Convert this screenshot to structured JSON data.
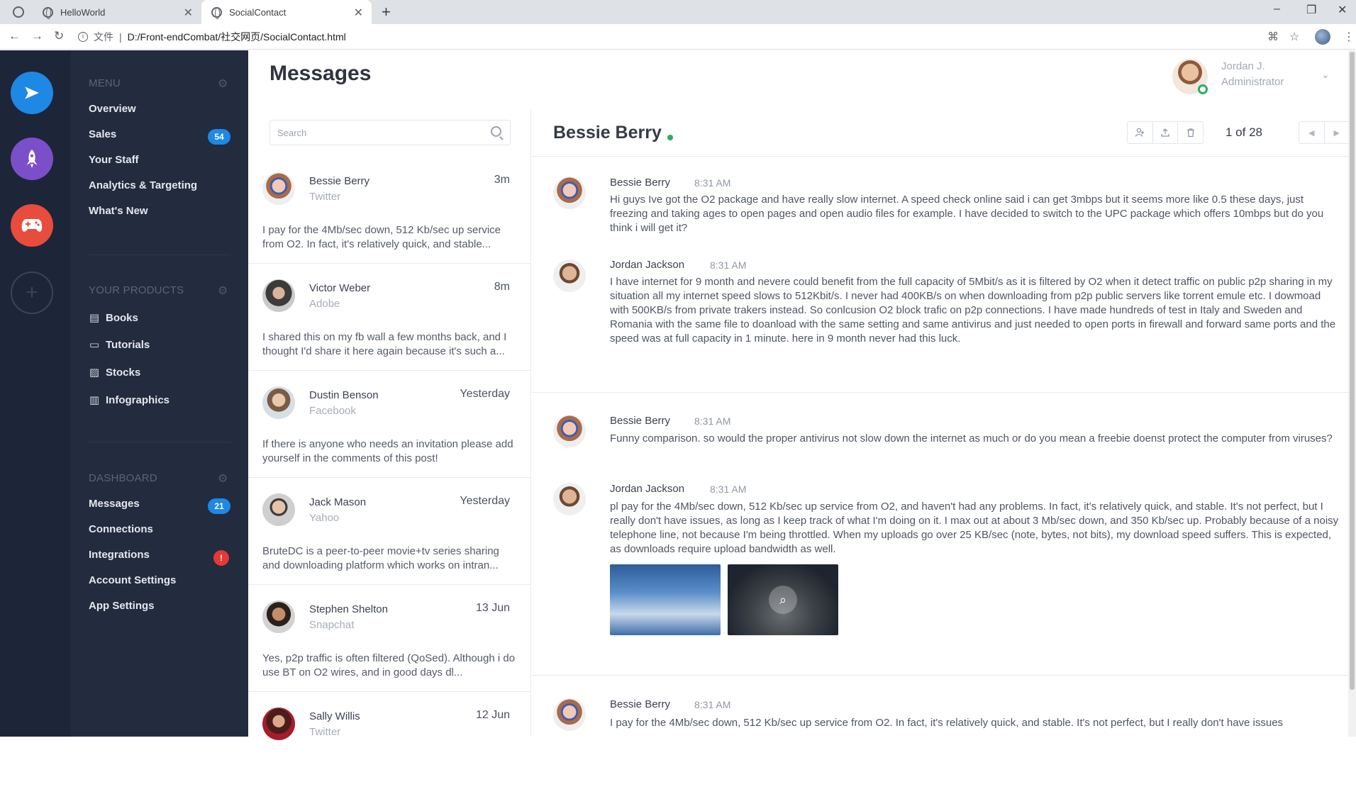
{
  "browser": {
    "tabs": [
      {
        "title": "HelloWorld",
        "active": false
      },
      {
        "title": "SocialContact",
        "active": true
      }
    ],
    "url_scheme_label": "文件",
    "url": "D:/Front-endCombat/社交网页/SocialContact.html"
  },
  "rail": {
    "buttons": [
      {
        "icon": "send-icon",
        "color": "#1e88e5"
      },
      {
        "icon": "rocket-icon",
        "color": "#7b4fc9"
      },
      {
        "icon": "gamepad-icon",
        "color": "#e74c3c"
      },
      {
        "icon": "plus-icon",
        "color": "#3a435a"
      }
    ]
  },
  "sidebar": {
    "menu_title": "MENU",
    "menu": [
      {
        "label": "Overview"
      },
      {
        "label": "Sales",
        "badge": "54"
      },
      {
        "label": "Your Staff"
      },
      {
        "label": "Analytics & Targeting"
      },
      {
        "label": "What's New"
      }
    ],
    "products_title": "YOUR PRODUCTS",
    "products": [
      {
        "label": "Books",
        "icon": "book-icon"
      },
      {
        "label": "Tutorials",
        "icon": "video-icon"
      },
      {
        "label": "Stocks",
        "icon": "image-icon"
      },
      {
        "label": "Infographics",
        "icon": "bar-chart-icon"
      }
    ],
    "dashboard_title": "DASHBOARD",
    "dashboard": [
      {
        "label": "Messages",
        "badge": "21"
      },
      {
        "label": "Connections"
      },
      {
        "label": "Integrations",
        "badge": "!"
      },
      {
        "label": "Account Settings"
      },
      {
        "label": "App Settings"
      }
    ]
  },
  "header": {
    "title": "Messages",
    "user_name": "Jordan J.",
    "user_role": "Administrator"
  },
  "search": {
    "placeholder": "Search"
  },
  "messages": [
    {
      "name": "Bessie Berry",
      "source": "Twitter",
      "time": "3m",
      "preview": "I pay for the 4Mb/sec down, 512 Kb/sec up service from O2. In fact, it's relatively quick, and stable..."
    },
    {
      "name": "Victor Weber",
      "source": "Adobe",
      "time": "8m",
      "preview": "I shared this on my fb wall a few months back, and I thought I'd share it here again because it's such a..."
    },
    {
      "name": "Dustin Benson",
      "source": "Facebook",
      "time": "Yesterday",
      "preview": "If there is anyone who needs an invitation please add yourself in the comments of this post!"
    },
    {
      "name": "Jack Mason",
      "source": "Yahoo",
      "time": "Yesterday",
      "preview": "BruteDC is a peer-to-peer movie+tv series sharing and downloading platform which works on intran..."
    },
    {
      "name": "Stephen Shelton",
      "source": "Snapchat",
      "time": "13 Jun",
      "preview": "Yes, p2p traffic is often filtered (QoSed). Although i do use BT on O2 wires, and in good days dl..."
    },
    {
      "name": "Sally Willis",
      "source": "Twitter",
      "time": "12 Jun",
      "preview": ""
    }
  ],
  "thread": {
    "name": "Bessie Berry",
    "pager": "1 of 28",
    "tools": [
      "add-user-icon",
      "upload-icon",
      "trash-icon"
    ],
    "posts": [
      {
        "author": "Bessie Berry",
        "time": "8:31 AM",
        "text": "Hi guys Ive got the O2 package and have really slow internet. A speed check online said i can get 3mbps but it seems more like 0.5 these days, just freezing and taking ages to open pages and open audio files for example. I have decided to switch to the UPC package which offers 10mbps but do you think i will get it?"
      },
      {
        "author": "Jordan Jackson",
        "time": "8:31 AM",
        "text": "I have internet for 9 month and nevere could benefit from the full capacity of 5Mbit/s as it is filtered by O2 when it detect traffic on public p2p sharing in my situation all my internet speed slows to 512Kbit/s. I never had 400KB/s on when downloading from p2p public servers like torrent emule etc. I dowmoad with 500KB/s from private trakers instead. So conlcusion O2 block trafic on p2p connections. I have made hundreds of test in Italy and Sweden and Romania with the same file to doanload with the same setting and same antivirus and just needed to open ports in firewall and forward same ports and the speed was at full capacity in 1 minute. here in 9 month never had this luck."
      },
      {
        "author": "Bessie Berry",
        "time": "8:31 AM",
        "text": "Funny comparison. so would the proper antivirus not slow down the internet as much or do you mean a freebie doenst protect the computer from viruses?"
      },
      {
        "author": "Jordan Jackson",
        "time": "8:31 AM",
        "text": "pl pay for the 4Mb/sec down, 512 Kb/sec up service from O2, and haven't had any problems. In fact, it's relatively quick, and stable. It's not perfect, but I really don't have issues, as long as I keep track of what I'm doing on it. I max out at about 3 Mb/sec down, and 350 Kb/sec up. Probably because of a noisy telephone line, not because I'm being throttled. When my uploads go over 25 KB/sec (note, bytes, not bits), my download speed suffers. This is expected, as downloads require upload bandwidth as well."
      },
      {
        "author": "Bessie Berry",
        "time": "8:31 AM",
        "text": "I pay for the 4Mb/sec down, 512 Kb/sec up service from O2. In fact, it's relatively quick, and stable. It's not perfect, but I really don't have issues"
      }
    ]
  }
}
